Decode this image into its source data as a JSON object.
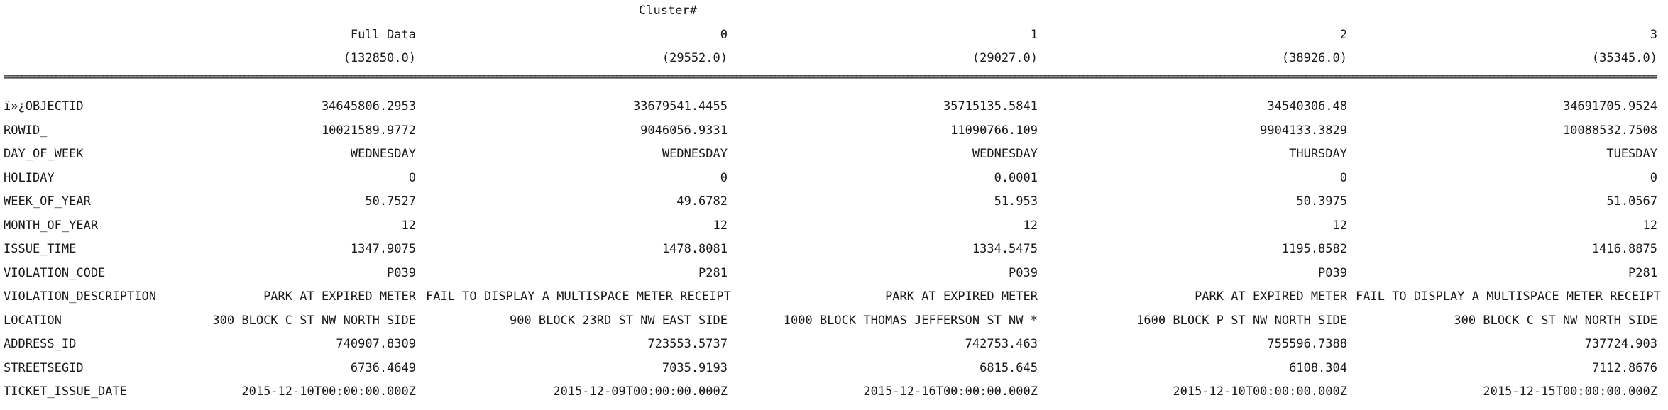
{
  "cluster_label": "Cluster#",
  "columns": [
    {
      "name": "Full Data",
      "count": "(132850.0)"
    },
    {
      "name": "0",
      "count": "(29552.0)"
    },
    {
      "name": "1",
      "count": "(29027.0)"
    },
    {
      "name": "2",
      "count": "(38926.0)"
    },
    {
      "name": "3",
      "count": "(35345.0)"
    }
  ],
  "separator": "======================================================================================================================================================================================================================================================================================================================================================================================================================================================================================================================================================================================================================================================================",
  "rows": [
    {
      "attribute": "ï»¿OBJECTID",
      "values": [
        "34645806.2953",
        "33679541.4455",
        "35715135.5841",
        "34540306.48",
        "34691705.9524"
      ]
    },
    {
      "attribute": "ROWID_",
      "values": [
        "10021589.9772",
        "9046056.9331",
        "11090766.109",
        "9904133.3829",
        "10088532.7508"
      ]
    },
    {
      "attribute": "DAY_OF_WEEK",
      "values": [
        "WEDNESDAY",
        "WEDNESDAY",
        "WEDNESDAY",
        "THURSDAY",
        "TUESDAY"
      ]
    },
    {
      "attribute": "HOLIDAY",
      "values": [
        "0",
        "0",
        "0.0001",
        "0",
        "0"
      ]
    },
    {
      "attribute": "WEEK_OF_YEAR",
      "values": [
        "50.7527",
        "49.6782",
        "51.953",
        "50.3975",
        "51.0567"
      ]
    },
    {
      "attribute": "MONTH_OF_YEAR",
      "values": [
        "12",
        "12",
        "12",
        "12",
        "12"
      ]
    },
    {
      "attribute": "ISSUE_TIME",
      "values": [
        "1347.9075",
        "1478.8081",
        "1334.5475",
        "1195.8582",
        "1416.8875"
      ]
    },
    {
      "attribute": "VIOLATION_CODE",
      "values": [
        "P039",
        "P281",
        "P039",
        "P039",
        "P281"
      ]
    },
    {
      "attribute": "VIOLATION_DESCRIPTION",
      "values": [
        "PARK AT EXPIRED METER",
        "FAIL TO DISPLAY A MULTISPACE METER RECEIPT",
        "PARK AT EXPIRED METER",
        "PARK AT EXPIRED METER",
        "FAIL TO DISPLAY A MULTISPACE METER RECEIPT"
      ]
    },
    {
      "attribute": "LOCATION",
      "values": [
        "300 BLOCK C ST NW NORTH SIDE",
        "900 BLOCK 23RD ST NW EAST SIDE",
        "1000 BLOCK THOMAS JEFFERSON ST NW *",
        "1600 BLOCK P ST NW NORTH SIDE",
        "300 BLOCK C ST NW NORTH SIDE"
      ]
    },
    {
      "attribute": "ADDRESS_ID",
      "values": [
        "740907.8309",
        "723553.5737",
        "742753.463",
        "755596.7388",
        "737724.903"
      ]
    },
    {
      "attribute": "STREETSEGID",
      "values": [
        "6736.4649",
        "7035.9193",
        "6815.645",
        "6108.304",
        "7112.8676"
      ]
    },
    {
      "attribute": "TICKET_ISSUE_DATE",
      "values": [
        "2015-12-10T00:00:00.000Z",
        "2015-12-09T00:00:00.000Z",
        "2015-12-16T00:00:00.000Z",
        "2015-12-10T00:00:00.000Z",
        "2015-12-15T00:00:00.000Z"
      ]
    }
  ]
}
